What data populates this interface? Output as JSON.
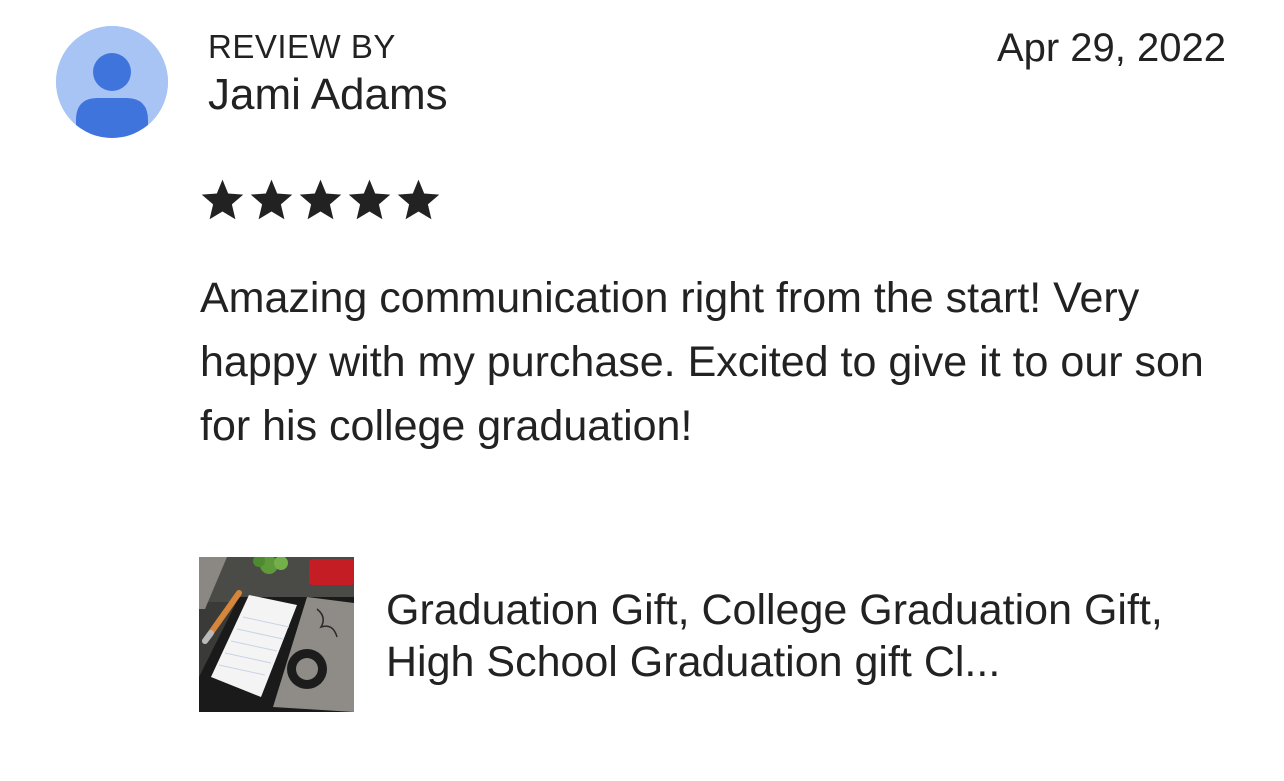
{
  "review": {
    "label": "REVIEW BY",
    "reviewer_name": "Jami Adams",
    "date": "Apr 29, 2022",
    "rating": 5,
    "max_rating": 5,
    "text": "Amazing communication right from the start! Very happy with my purchase. Excited to give it to our son for his college graduation!"
  },
  "product": {
    "title": "Graduation Gift, College Graduation Gift, High School Graduation gift Cl..."
  },
  "colors": {
    "avatar_bg": "#a7c4f5",
    "avatar_fg": "#3f74dd",
    "star": "#222222",
    "text": "#222222"
  },
  "icons": {
    "avatar": "default-user-avatar-icon",
    "star": "filled-star-icon"
  }
}
